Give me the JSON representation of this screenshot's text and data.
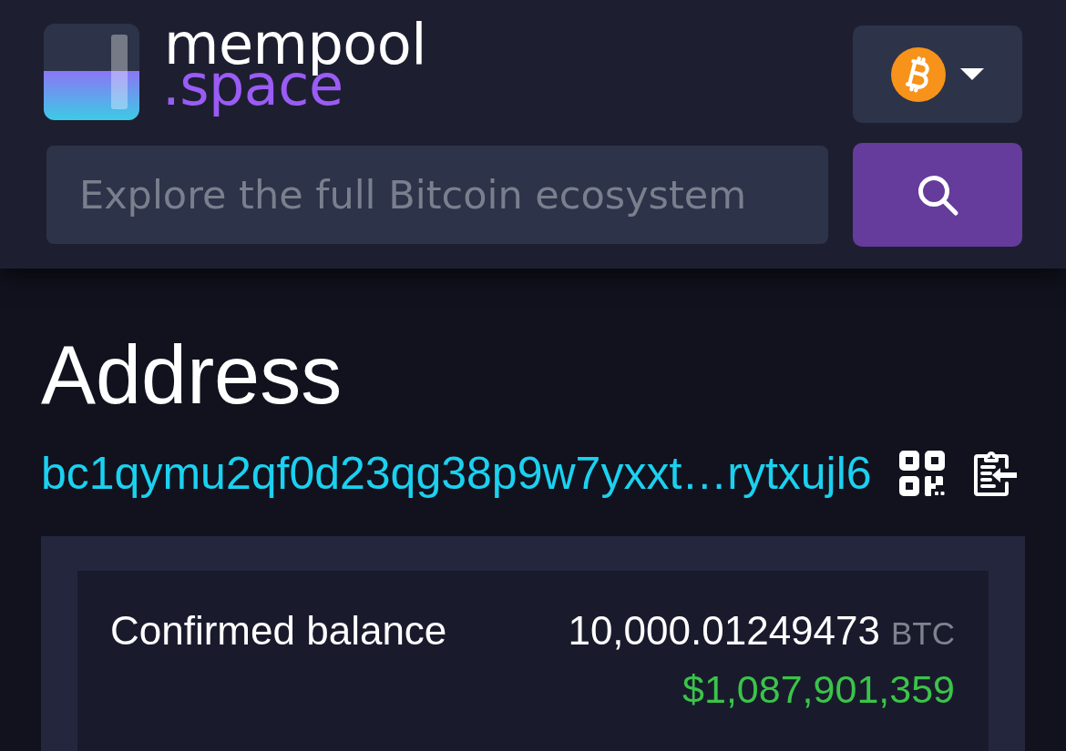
{
  "header": {
    "logo": {
      "wordmark": "mempool",
      "suffix": ".space"
    },
    "search": {
      "placeholder": "Explore the full Bitcoin ecosystem"
    }
  },
  "address_page": {
    "title": "Address",
    "address": "bc1qymu2qf0d23qg38p9w7yxxt…rytxujl6"
  },
  "balance_table": {
    "rows": [
      {
        "label": "Confirmed balance",
        "amount": "10,000.01249473",
        "unit": "BTC",
        "fiat": "$1,087,901,359"
      }
    ]
  }
}
